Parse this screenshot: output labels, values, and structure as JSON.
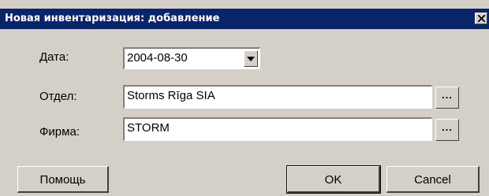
{
  "window": {
    "title": "Новая инвентаризация: добавление",
    "close_glyph": "×"
  },
  "fields": {
    "date": {
      "label": "Дата:",
      "value": "2004-08-30"
    },
    "department": {
      "label": "Отдел:",
      "value": "Storms Rīga SIA",
      "browse": "..."
    },
    "company": {
      "label": "Фирма:",
      "value": "STORM",
      "browse": "..."
    }
  },
  "buttons": {
    "help": "Помощь",
    "ok": "OK",
    "cancel": "Cancel"
  },
  "icons": {
    "close": "close-icon",
    "dropdown": "chevron-down-icon"
  },
  "colors": {
    "titlebar": "#0a246a",
    "face": "#d4d0c8"
  }
}
